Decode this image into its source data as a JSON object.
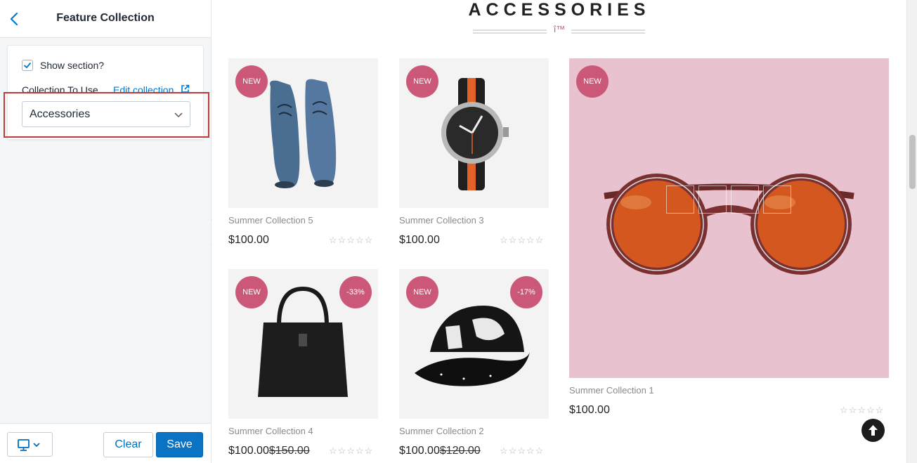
{
  "sidebar": {
    "title": "Feature Collection",
    "show_section_label": "Show section?",
    "show_section_checked": true,
    "collection_label": "Collection To Use",
    "edit_link": "Edit collection",
    "selected_collection": "Accessories",
    "footer": {
      "clear_label": "Clear",
      "save_label": "Save"
    }
  },
  "preview": {
    "section_title": "ACCESSORIES",
    "title_glyph": "î™",
    "products": [
      {
        "name": "Summer Collection 5",
        "price": "$100.00",
        "old_price": "",
        "badge_new": "NEW",
        "badge_sale": "",
        "image": "blue-suede-shoes"
      },
      {
        "name": "Summer Collection 3",
        "price": "$100.00",
        "old_price": "",
        "badge_new": "NEW",
        "badge_sale": "",
        "image": "wrist-watch"
      },
      {
        "name": "Summer Collection 1",
        "price": "$100.00",
        "old_price": "",
        "badge_new": "NEW",
        "badge_sale": "",
        "image": "sunglasses"
      },
      {
        "name": "Summer Collection 4",
        "price": "$100.00",
        "old_price": "$150.00",
        "badge_new": "NEW",
        "badge_sale": "-33%",
        "image": "leather-tote-bag"
      },
      {
        "name": "Summer Collection 2",
        "price": "$100.00",
        "old_price": "$120.00",
        "badge_new": "NEW",
        "badge_sale": "-17%",
        "image": "snapback-cap"
      }
    ]
  },
  "colors": {
    "accent": "#cc5879",
    "link": "#007ace",
    "save": "#0a73c4",
    "highlight": "#c0393b",
    "featured_bg": "#e8c3cf"
  }
}
